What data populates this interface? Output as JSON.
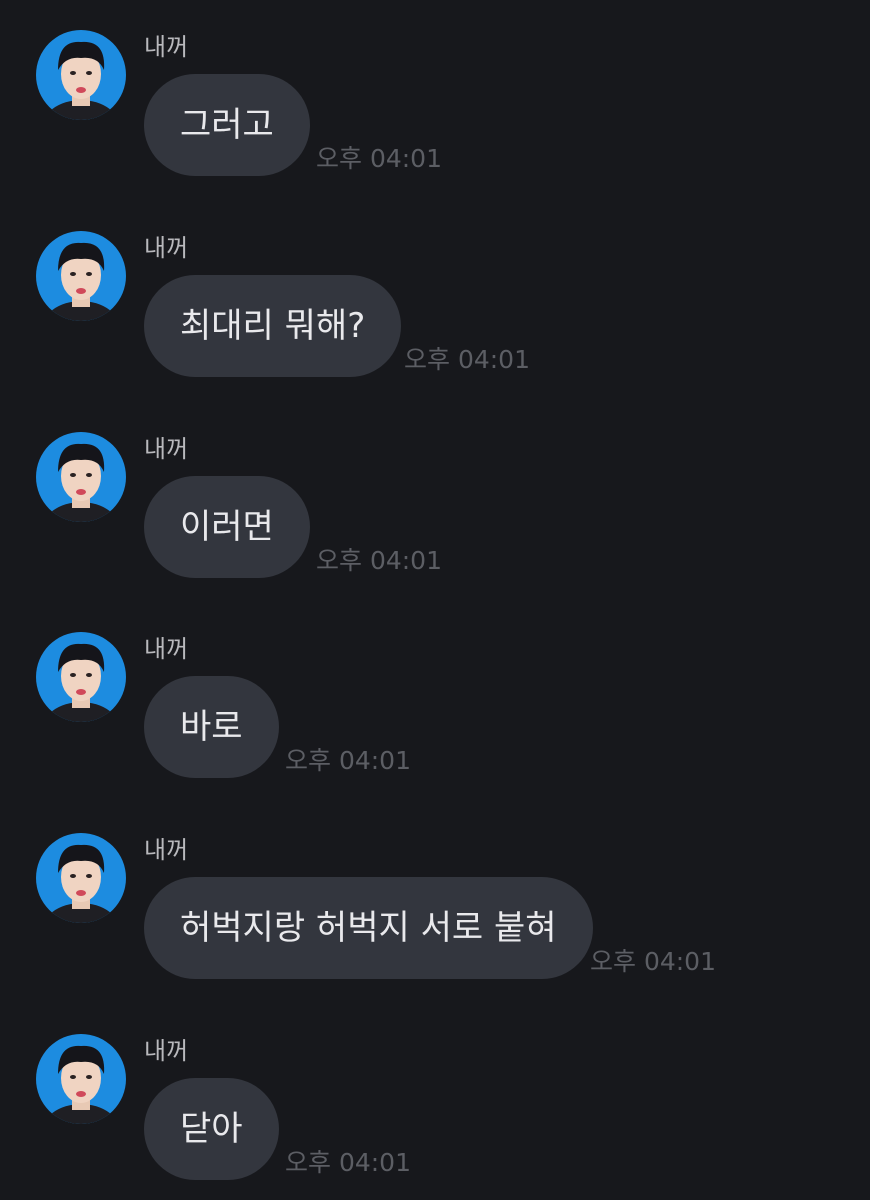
{
  "messages": [
    {
      "sender": "내꺼",
      "text": "그러고",
      "time": "오후 04:01"
    },
    {
      "sender": "내꺼",
      "text": "최대리 뭐해?",
      "time": "오후 04:01"
    },
    {
      "sender": "내꺼",
      "text": "이러면",
      "time": "오후 04:01"
    },
    {
      "sender": "내꺼",
      "text": "바로",
      "time": "오후 04:01"
    },
    {
      "sender": "내꺼",
      "text": "허벅지랑 허벅지 서로 붙혀",
      "time": "오후 04:01"
    },
    {
      "sender": "내꺼",
      "text": "닫아",
      "time": "오후 04:01"
    }
  ],
  "colors": {
    "background": "#17181c",
    "bubble": "#33363e",
    "avatar_bg": "#1d8ce0"
  },
  "icons": {
    "avatar": "profile-photo"
  }
}
